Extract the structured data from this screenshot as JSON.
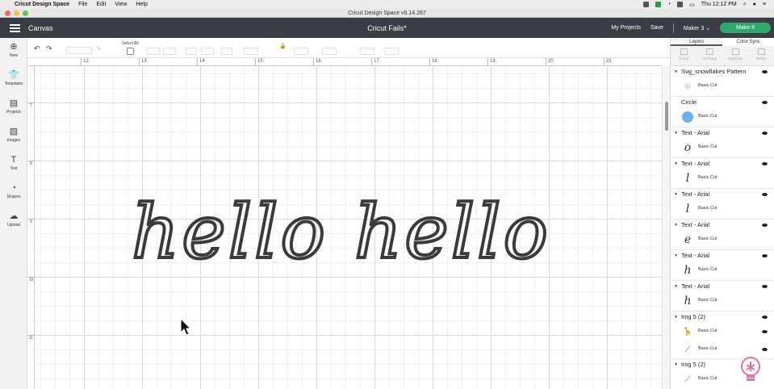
{
  "menubar": {
    "app_name": "Cricut Design Space",
    "menus": [
      "File",
      "Edit",
      "View",
      "Help"
    ],
    "clock": "Thu 12:12 PM"
  },
  "window": {
    "title": "Cricut Design Space  v6.14.267"
  },
  "header": {
    "canvas_label": "Canvas",
    "document_title": "Cricut Fails*",
    "my_projects": "My Projects",
    "save": "Save",
    "machine": "Maker 3",
    "make_it": "Make It"
  },
  "left_toolbar": [
    {
      "label": "New",
      "icon": "plus-circle-icon",
      "glyph": "⊕"
    },
    {
      "label": "Templates",
      "icon": "shirt-icon",
      "glyph": "👕"
    },
    {
      "label": "Projects",
      "icon": "projects-icon",
      "glyph": "▤"
    },
    {
      "label": "Images",
      "icon": "images-icon",
      "glyph": "▨"
    },
    {
      "label": "Text",
      "icon": "text-icon",
      "glyph": "T"
    },
    {
      "label": "Shapes",
      "icon": "shapes-icon",
      "glyph": "◔"
    },
    {
      "label": "Upload",
      "icon": "upload-cloud-icon",
      "glyph": "☁"
    }
  ],
  "edit_toolbar": {
    "select_all": "Select All"
  },
  "ruler": {
    "top": [
      "12",
      "13",
      "14",
      "15",
      "16",
      "17",
      "18",
      "19",
      "20",
      "21"
    ],
    "left": [
      "7",
      "8",
      "9",
      "10",
      "11"
    ]
  },
  "canvas": {
    "text_left": "hello",
    "text_right": "hello"
  },
  "panel": {
    "tabs": [
      "Layers",
      "Color Sync"
    ],
    "tools": [
      "Group",
      "UnGroup",
      "Duplicate",
      "Delete"
    ],
    "layers": [
      {
        "name": "Svg_snowflakes Pattern",
        "items": [
          {
            "cut": "Basic Cut",
            "thumb": "snowflake-pattern-icon",
            "glyph": "❄"
          }
        ]
      },
      {
        "name": "Circle",
        "items": [
          {
            "cut": "Basic Cut",
            "thumb": "circle-shape",
            "glyph": ""
          }
        ]
      },
      {
        "name": "Text - Arial",
        "items": [
          {
            "cut": "Basic Cut",
            "thumb": "letter-o",
            "glyph": "o"
          }
        ]
      },
      {
        "name": "Text - Arial",
        "items": [
          {
            "cut": "Basic Cut",
            "thumb": "letter-l",
            "glyph": "l"
          }
        ]
      },
      {
        "name": "Text - Arial",
        "items": [
          {
            "cut": "Basic Cut",
            "thumb": "letter-l",
            "glyph": "l"
          }
        ]
      },
      {
        "name": "Text - Arial",
        "items": [
          {
            "cut": "Basic Cut",
            "thumb": "letter-e",
            "glyph": "e"
          }
        ]
      },
      {
        "name": "Text - Arial",
        "items": [
          {
            "cut": "Basic Cut",
            "thumb": "letter-h",
            "glyph": "h"
          }
        ]
      },
      {
        "name": "Text - Arial",
        "items": [
          {
            "cut": "Basic Cut",
            "thumb": "letter-h",
            "glyph": "h"
          }
        ]
      },
      {
        "name": "Img 5 (2)",
        "items": [
          {
            "cut": "Basic Cut",
            "thumb": "image-icon",
            "glyph": "🦒"
          },
          {
            "cut": "Basic Cut",
            "thumb": "image-icon",
            "glyph": "⟋"
          }
        ]
      },
      {
        "name": "Img 5 (2)",
        "items": [
          {
            "cut": "Basic Cut",
            "thumb": "image-icon",
            "glyph": "⟋"
          }
        ]
      }
    ]
  },
  "colors": {
    "header_bg": "#3a3e44",
    "make_it_green": "#2fa86b",
    "circle_blue": "#6ab2ee",
    "text_stroke": "#3b3b3b"
  }
}
